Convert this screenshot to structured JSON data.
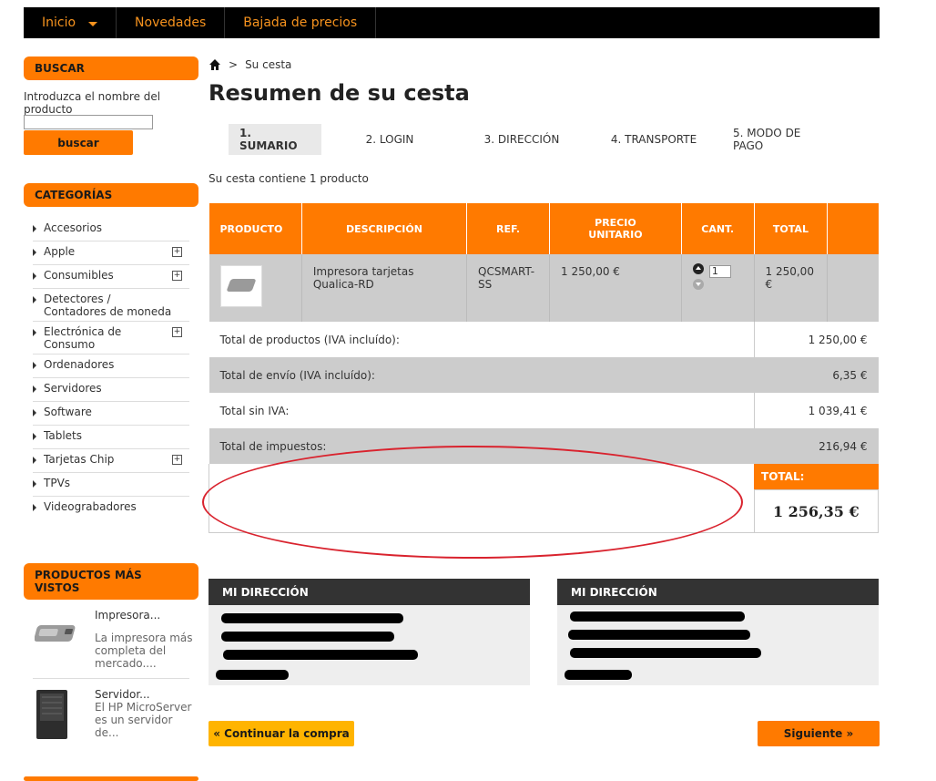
{
  "topnav": {
    "items": [
      "Inicio",
      "Novedades",
      "Bajada de precios"
    ]
  },
  "sidebar": {
    "search": {
      "header": "BUSCAR",
      "label": "Introduzca el nombre del producto",
      "input_value": "",
      "button": "buscar"
    },
    "categories": {
      "header": "CATEGORÍAS",
      "items": [
        {
          "label": "Accesorios",
          "expandable": false
        },
        {
          "label": "Apple",
          "expandable": true
        },
        {
          "label": "Consumibles",
          "expandable": true
        },
        {
          "label": "Detectores / Contadores de moneda",
          "expandable": false
        },
        {
          "label": "Electrónica de Consumo",
          "expandable": true
        },
        {
          "label": "Ordenadores",
          "expandable": false
        },
        {
          "label": "Servidores",
          "expandable": false
        },
        {
          "label": "Software",
          "expandable": false
        },
        {
          "label": "Tablets",
          "expandable": false
        },
        {
          "label": "Tarjetas Chip",
          "expandable": true
        },
        {
          "label": "TPVs",
          "expandable": false
        },
        {
          "label": "Videograbadores",
          "expandable": false
        }
      ]
    },
    "most_viewed": {
      "header": "PRODUCTOS MÁS VISTOS",
      "items": [
        {
          "name": "Impresora...",
          "desc": "La impresora más completa del mercado...."
        },
        {
          "name": "Servidor...",
          "desc": "El HP MicroServer es un servidor de..."
        }
      ]
    }
  },
  "breadcrumb": {
    "current": "Su cesta"
  },
  "page_title": "Resumen de su cesta",
  "steps": [
    {
      "label": "1. SUMARIO",
      "active": true
    },
    {
      "label": "2. LOGIN",
      "active": false
    },
    {
      "label": "3. DIRECCIÓN",
      "active": false
    },
    {
      "label": "4. TRANSPORTE",
      "active": false
    },
    {
      "label": "5. MODO DE PAGO",
      "active": false
    }
  ],
  "cart_count_text": "Su cesta contiene 1 producto",
  "cart_table": {
    "headers": [
      "PRODUCTO",
      "DESCRIPCIÓN",
      "REF.",
      "PRECIO UNITARIO",
      "CANT.",
      "TOTAL"
    ],
    "rows": [
      {
        "description": "Impresora tarjetas Qualica-RD",
        "ref": "QCSMART-SS",
        "unit_price": "1 250,00 €",
        "quantity": "1",
        "total": "1 250,00 €"
      }
    ],
    "summary": [
      {
        "label": "Total de productos (IVA incluído):",
        "value": "1 250,00 €"
      },
      {
        "label": "Total de envío (IVA incluído):",
        "value": "6,35 €"
      },
      {
        "label": "Total sin IVA:",
        "value": "1 039,41 €"
      },
      {
        "label": "Total de impuestos:",
        "value": "216,94 €"
      }
    ],
    "grand_total_label": "TOTAL:",
    "grand_total_value": "1 256,35 €"
  },
  "addresses": [
    {
      "header": "MI DIRECCIÓN"
    },
    {
      "header": "MI DIRECCIÓN"
    }
  ],
  "buttons": {
    "continue": "« Continuar la compra",
    "next": "Siguiente »"
  },
  "colors": {
    "accent": "#ff7a00",
    "nav_bg": "#000000",
    "nav_text": "#f7931e",
    "annotation_red": "#d9232e"
  }
}
